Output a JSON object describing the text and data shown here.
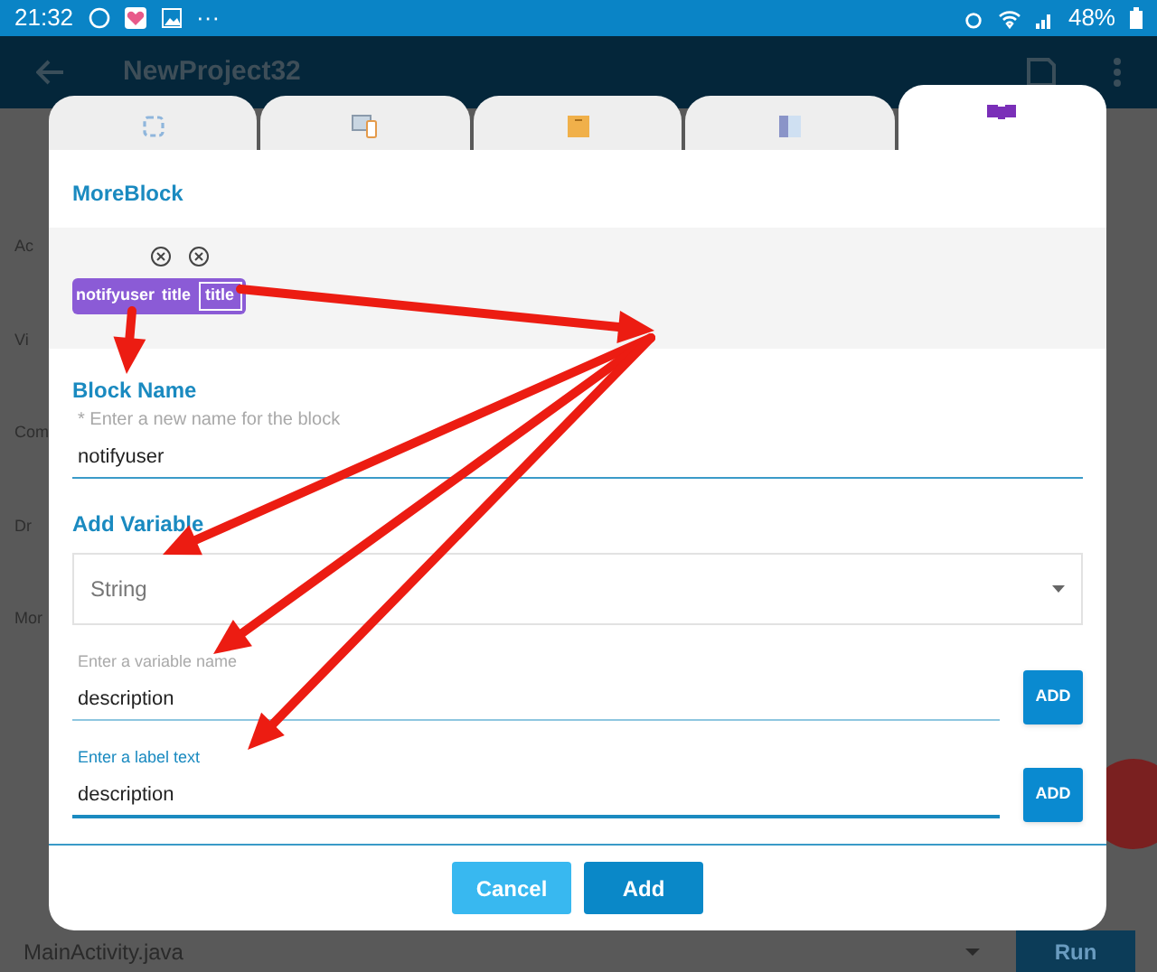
{
  "status_bar": {
    "time": "21:32",
    "more": "···",
    "battery": "48%"
  },
  "app_bar": {
    "title": "NewProject32"
  },
  "sidebar": {
    "items": [
      {
        "label": "Ac"
      },
      {
        "label": "Vi"
      },
      {
        "label": "Com"
      },
      {
        "label": "Dr"
      },
      {
        "label": "Mor"
      }
    ]
  },
  "dialog": {
    "tabs": [
      {
        "kind": "view",
        "selected": false
      },
      {
        "kind": "component",
        "selected": false
      },
      {
        "kind": "event",
        "selected": false
      },
      {
        "kind": "drawer",
        "selected": false
      },
      {
        "kind": "moreblock",
        "selected": true
      }
    ],
    "section_title": "MoreBlock",
    "block_preview": {
      "name": "notifyuser",
      "label": "title",
      "param": "title"
    },
    "block_name": {
      "title": "Block Name",
      "hint": "* Enter a new name for the block",
      "value": "notifyuser"
    },
    "add_variable": {
      "title": "Add Variable",
      "type": "String",
      "fields": [
        {
          "placeholder": "Enter a variable name",
          "value": "description",
          "focused": false,
          "button": "ADD"
        },
        {
          "placeholder": "Enter a label text",
          "value": "description",
          "focused": true,
          "button": "ADD"
        }
      ]
    },
    "buttons": [
      {
        "label": "Cancel",
        "kind": "secondary"
      },
      {
        "label": "Add",
        "kind": "primary"
      }
    ]
  },
  "bottom_bar": {
    "file": "MainActivity.java",
    "run": "Run"
  }
}
